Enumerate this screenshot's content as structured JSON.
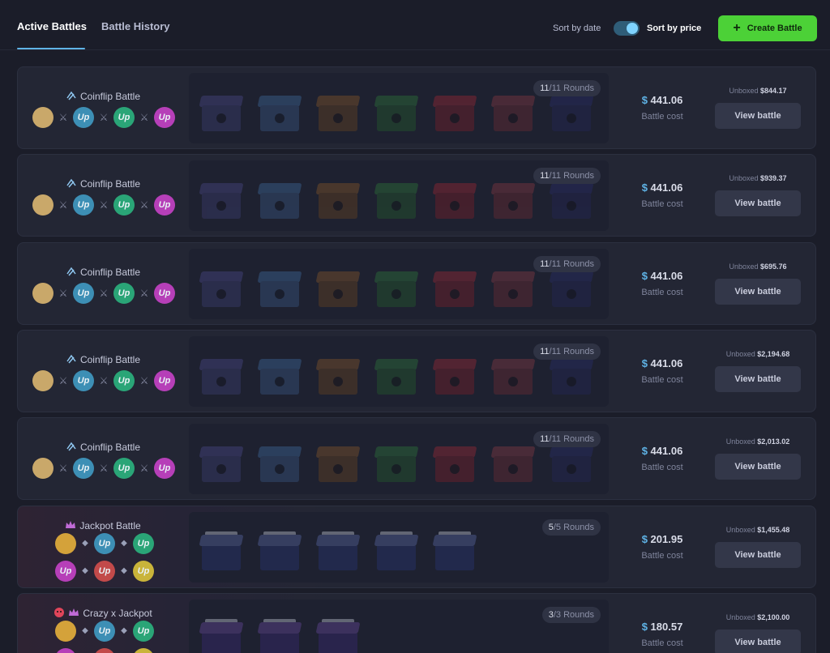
{
  "tabs": {
    "active": "Active Battles",
    "history": "Battle History"
  },
  "sort": {
    "by_date": "Sort by date",
    "by_price": "Sort by price",
    "price_selected": true
  },
  "create_button": {
    "label": "Create Battle",
    "icon": "plus-icon"
  },
  "colors": {
    "accent": "#5fb3e6",
    "create": "#4cd137"
  },
  "battles": [
    {
      "mode": "Coinflip Battle",
      "rounds_done": "11",
      "rounds_total": "/11 Rounds",
      "price_symbol": "$",
      "price": "441.06",
      "cost_label": "Battle cost",
      "unboxed_label": "Unboxed",
      "unboxed": "$844.17",
      "view_label": "View battle"
    },
    {
      "mode": "Coinflip Battle",
      "rounds_done": "11",
      "rounds_total": "/11 Rounds",
      "price_symbol": "$",
      "price": "441.06",
      "cost_label": "Battle cost",
      "unboxed_label": "Unboxed",
      "unboxed": "$939.37",
      "view_label": "View battle"
    },
    {
      "mode": "Coinflip Battle",
      "rounds_done": "11",
      "rounds_total": "/11 Rounds",
      "price_symbol": "$",
      "price": "441.06",
      "cost_label": "Battle cost",
      "unboxed_label": "Unboxed",
      "unboxed": "$695.76",
      "view_label": "View battle"
    },
    {
      "mode": "Coinflip Battle",
      "rounds_done": "11",
      "rounds_total": "/11 Rounds",
      "price_symbol": "$",
      "price": "441.06",
      "cost_label": "Battle cost",
      "unboxed_label": "Unboxed",
      "unboxed": "$2,194.68",
      "view_label": "View battle"
    },
    {
      "mode": "Coinflip Battle",
      "rounds_done": "11",
      "rounds_total": "/11 Rounds",
      "price_symbol": "$",
      "price": "441.06",
      "cost_label": "Battle cost",
      "unboxed_label": "Unboxed",
      "unboxed": "$2,013.02",
      "view_label": "View battle"
    },
    {
      "mode": "Jackpot Battle",
      "rounds_done": "5",
      "rounds_total": "/5 Rounds",
      "price_symbol": "$",
      "price": "201.95",
      "cost_label": "Battle cost",
      "unboxed_label": "Unboxed",
      "unboxed": "$1,455.48",
      "view_label": "View battle"
    },
    {
      "mode": "Crazy x Jackpot",
      "rounds_done": "3",
      "rounds_total": "/3 Rounds",
      "price_symbol": "$",
      "price": "180.57",
      "cost_label": "Battle cost",
      "unboxed_label": "Unboxed",
      "unboxed": "$2,100.00",
      "view_label": "View battle"
    }
  ],
  "player_initials": "Up"
}
